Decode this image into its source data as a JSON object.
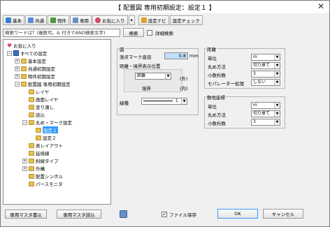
{
  "window": {
    "title": "【 配置図 専用初期設定：設定１ 】",
    "close_glyph": "✕"
  },
  "toolbar": {
    "buttons": [
      {
        "label": "基本",
        "color": "#3a7bd5"
      },
      {
        "label": "共通",
        "color": "#3a7bd5"
      },
      {
        "label": "物件",
        "color": "#4a9a3a"
      },
      {
        "label": "専用",
        "color": "#3a7bd5"
      },
      {
        "label": "お気に入り",
        "color": "#3a7bd5"
      }
    ],
    "dropdown_glyph": "▾",
    "settings_navi": "設定ナビ",
    "settings_check": "設定チェック"
  },
  "search": {
    "value": "検索ワードは？(複数可。& 付きでAND検索文字)",
    "button": "検索",
    "detail_label": "詳細検索"
  },
  "tree": {
    "items": [
      {
        "label": "お気に入り",
        "icon": "heart"
      },
      {
        "label": "すべての設定",
        "expander": "−"
      },
      {
        "label": "基本設定",
        "expander": "+"
      },
      {
        "label": "共通初期設定",
        "expander": "+"
      },
      {
        "label": "物件初期設定",
        "expander": "+"
      },
      {
        "label": "配置図 専用初期設定",
        "expander": "−"
      },
      {
        "label": "レイヤ"
      },
      {
        "label": "画面レイヤ"
      },
      {
        "label": "塗り潰し"
      },
      {
        "label": "読込"
      },
      {
        "label": "丸め・マーク設定",
        "expander": "−"
      },
      {
        "label": "設定１",
        "selected": true
      },
      {
        "label": "設定２"
      },
      {
        "label": "表レイアウト"
      },
      {
        "label": "延焼線"
      },
      {
        "label": "斜線タイプ",
        "expander": "+"
      },
      {
        "label": "外構",
        "expander": "+"
      },
      {
        "label": "配置シンボル"
      },
      {
        "label": "パースモニタ"
      }
    ]
  },
  "zu": {
    "title": "図",
    "mark_diameter_label": "測点マーク直径",
    "mark_diameter_value": "0.8",
    "mark_unit": "mm",
    "distance_pos_label": "距離・境界表示位置",
    "distance_select": "距離",
    "distance_suffix": "(外)",
    "boundary_label": "境界",
    "boundary_suffix": "(内)",
    "linetype_label": "線種",
    "linetype_value": "1"
  },
  "kyori": {
    "title": "距離",
    "rows": [
      {
        "label": "単位",
        "value": "m"
      },
      {
        "label": "丸め方法",
        "value": "切り捨て"
      },
      {
        "label": "小数桁数",
        "value": "3"
      },
      {
        "label": "セパレーター処理",
        "value": "しない"
      }
    ]
  },
  "shikichi": {
    "title": "敷地座標",
    "rows": [
      {
        "label": "単位",
        "value": "m"
      },
      {
        "label": "丸め方法",
        "value": "切り捨て"
      },
      {
        "label": "小数桁数",
        "value": "3"
      }
    ]
  },
  "footer": {
    "export_button": "専用マスタ書込",
    "import_button": "専用マスタ読込",
    "save_file_label": "ファイル保存",
    "save_file_checked": "✓",
    "ok": "OK",
    "cancel": "キャンセル"
  },
  "colors": {
    "selection": "#3399ff",
    "input_highlight": "#bfe0ff"
  }
}
